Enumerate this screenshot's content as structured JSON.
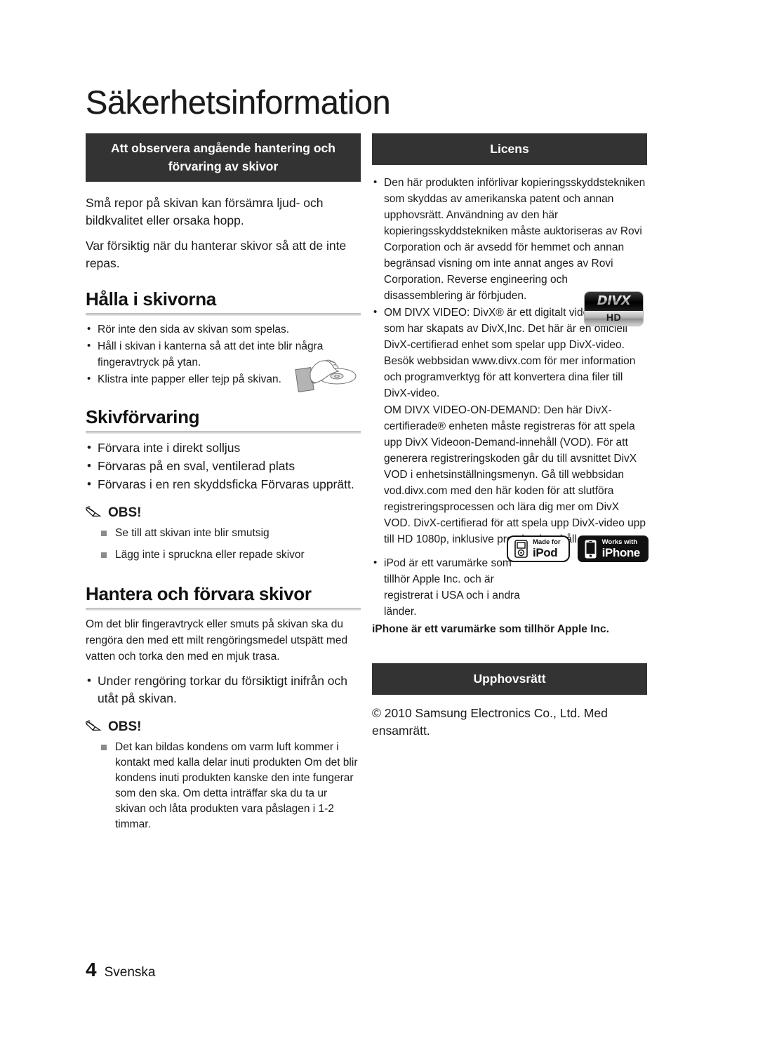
{
  "document": {
    "page_title": "Säkerhetsinformation",
    "footer": {
      "page_number": "4",
      "language": "Svenska"
    },
    "colors": {
      "banner_background": "#333333",
      "banner_text": "#ffffff",
      "body_text": "#1b1b1b",
      "rule": "#c9c9c9"
    }
  },
  "left_column": {
    "banner": "Att observera angående hantering och förvaring av skivor",
    "intro_paragraphs": [
      "Små repor på skivan kan försämra ljud- och bildkvalitet eller orsaka hopp.",
      "Var försiktig när du hanterar skivor så att de inte repas."
    ],
    "section_handling": {
      "heading": "Hålla i skivorna",
      "bullets": [
        "Rör inte den sida av skivan som spelas.",
        "Håll i skivan i kanterna så att det inte blir några fingeravtryck på ytan.",
        "Klistra inte papper eller tejp på skivan."
      ]
    },
    "section_storage": {
      "heading": "Skivförvaring",
      "bullets": [
        "Förvara inte i direkt solljus",
        "Förvaras på en sval, ventilerad plats",
        "Förvaras i en ren skyddsficka Förvaras upprätt."
      ],
      "note": {
        "label": "OBS!",
        "items": [
          "Se till att skivan inte blir smutsig",
          "Lägg inte i spruckna eller repade skivor"
        ]
      }
    },
    "section_care": {
      "heading": "Hantera och förvara skivor",
      "paragraph": "Om det blir fingeravtryck eller smuts på skivan ska du rengöra den med ett milt rengöringsmedel utspätt med vatten och torka den med en mjuk trasa.",
      "bullets": [
        "Under rengöring torkar du försiktigt inifrån och utåt på skivan."
      ],
      "note": {
        "label": "OBS!",
        "items": [
          "Det kan bildas kondens om varm luft kommer i kontakt med kalla delar inuti produkten Om det blir kondens inuti produkten kanske den inte fungerar som den ska. Om detta inträffar ska du ta ur skivan och låta produkten vara påslagen i 1-2 timmar."
        ]
      }
    }
  },
  "right_column": {
    "license": {
      "banner": "Licens",
      "bullets": [
        "Den här produkten införlivar kopieringsskyddstekniken som skyddas av amerikanska patent och annan upphovsrätt. Användning av den här kopieringsskyddstekniken måste auktoriseras av Rovi Corporation och är avsedd för hemmet och annan begränsad visning om inte annat anges av Rovi Corporation. Reverse engineering och disassemblering är förbjuden.",
        "OM DIVX VIDEO: DivX® är ett digitalt videoformat som har skapats av DivX,Inc. Det här är en officiell DivX-certifierad enhet som spelar upp DivX-video. Besök webbsidan www.divx.com för mer information och programverktyg för att konvertera dina filer till DivX-video."
      ],
      "divx_vod_paragraph": "OM DIVX VIDEO-ON-DEMAND: Den här DivX-certifierade® enheten måste registreras för att spela upp DivX Videoon-Demand-innehåll (VOD). För att generera registreringskoden går du till avsnittet DivX VOD i enhetsinställningsmenyn. Gå till webbsidan vod.divx.com med den här koden för att slutföra registreringsprocessen och lära dig mer om DivX VOD. DivX-certifierad för att spela upp DivX-video upp till HD 1080p, inklusive premiuminnehåll.",
      "apple_bullet": "iPod är ett varumärke som tillhör Apple Inc. och är registrerat i USA och i andra länder.",
      "apple_trailing": "iPhone är ett varumärke som tillhör Apple Inc."
    },
    "copyright": {
      "banner": "Upphovsrätt",
      "text": "© 2010 Samsung Electronics Co., Ltd. Med ensamrätt."
    },
    "logos": {
      "divx": {
        "word": "DIVX",
        "sub": "HD"
      },
      "ipod_badge": {
        "small": "Made for",
        "big": "iPod"
      },
      "iphone_badge": {
        "small": "Works with",
        "big": "iPhone"
      }
    }
  }
}
